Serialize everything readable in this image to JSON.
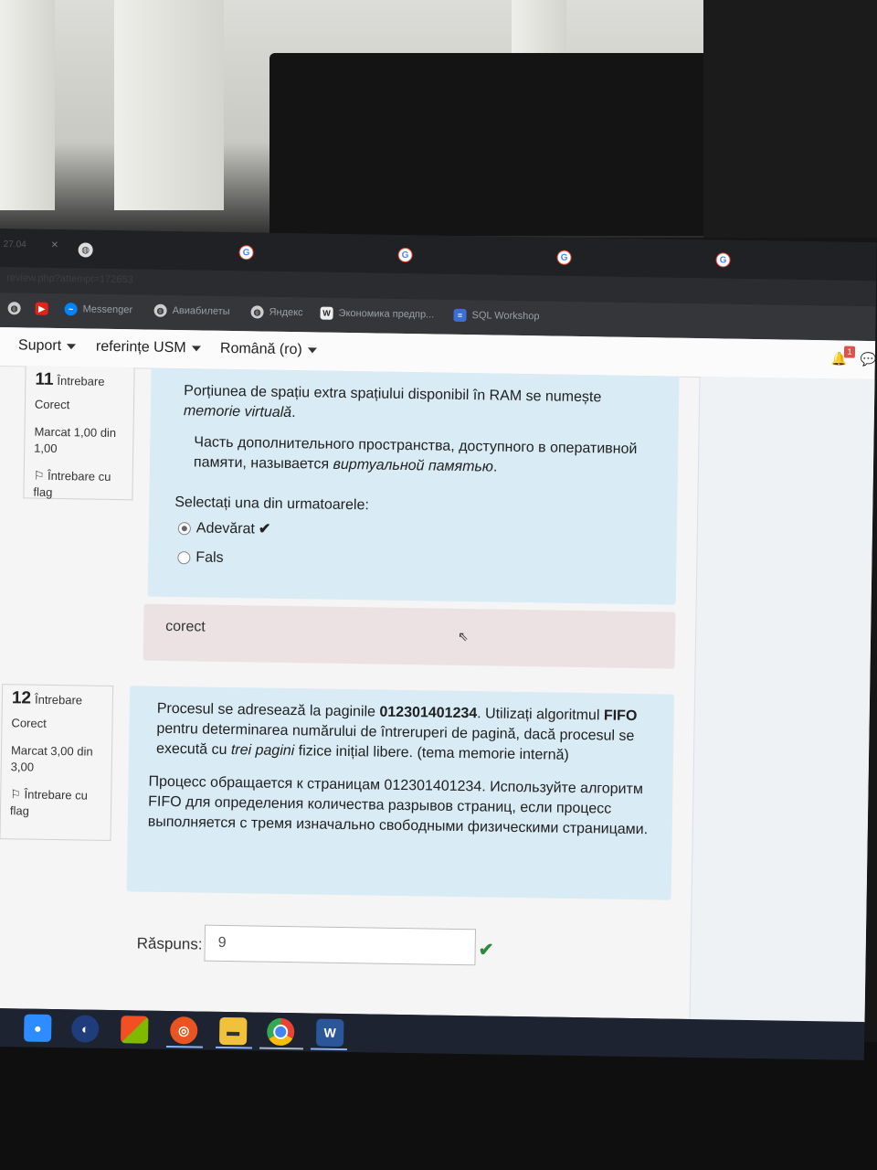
{
  "browser": {
    "tabs": [
      {
        "title": "27.04",
        "icon": "globe-icon"
      },
      {
        "title": "",
        "icon": "globe-icon"
      },
      {
        "title": "",
        "icon": "google-icon"
      },
      {
        "title": "",
        "icon": "google-icon"
      },
      {
        "title": "",
        "icon": "google-icon"
      },
      {
        "title": "",
        "icon": "google-icon"
      }
    ],
    "url_fragment": "review.php?attempt=172653",
    "bookmarks": [
      {
        "label": "",
        "icon": "globe-icon"
      },
      {
        "label": "",
        "icon": "youtube-icon"
      },
      {
        "label": "Messenger",
        "icon": "messenger-icon"
      },
      {
        "label": "Авиабилеты",
        "icon": "globe-icon"
      },
      {
        "label": "Яндекс",
        "icon": "globe-icon"
      },
      {
        "label": "Экономика предпр...",
        "icon": "w-icon"
      },
      {
        "label": "SQL Workshop",
        "icon": "sql-icon"
      }
    ]
  },
  "navbar": {
    "items": [
      "Suport",
      "referințe USM",
      "Română (ro)"
    ],
    "notification_badge": "1"
  },
  "questions": [
    {
      "number": "11",
      "word": "Întrebare",
      "state": "Corect",
      "mark": "Marcat 1,00 din 1,00",
      "flag_label": "Întrebare cu flag",
      "text_ro_start": "Porțiunea de spațiu extra spațiului disponibil în RAM se numește ",
      "text_ro_em": "memorie virtuală",
      "text_ro_end": ".",
      "text_ru_start": "Часть дополнительного пространства, доступного в оперативной памяти, называется ",
      "text_ru_em": "виртуальной памятью",
      "text_ru_end": ".",
      "prompt": "Selectați una din urmatoarele:",
      "options": [
        {
          "label": "Adevărat",
          "checked": true,
          "correct_mark": true
        },
        {
          "label": "Fals",
          "checked": false,
          "correct_mark": false
        }
      ],
      "feedback": "corect"
    },
    {
      "number": "12",
      "word": "Întrebare",
      "state": "Corect",
      "mark": "Marcat 3,00 din 3,00",
      "flag_label": "Întrebare cu flag",
      "text_ro_1": "Procesul se adresează la paginile ",
      "text_ro_b1": "012301401234",
      "text_ro_2": ". Utilizați algoritmul ",
      "text_ro_b2": "FIFO",
      "text_ro_3": " pentru determinarea numărului de întreruperi de pagină, dacă procesul se execută cu ",
      "text_ro_em": "trei pagini",
      "text_ro_4": " fizice inițial libere. (tema memorie internă)",
      "text_ru": "Процесс обращается к страницам 012301401234. Используйте алгоритм FIFO для определения количества разрывов страниц, если процесс выполняется с тремя изначально свободными физическими страницами.",
      "answer_label": "Răspuns:",
      "answer_value": "9"
    }
  ]
}
